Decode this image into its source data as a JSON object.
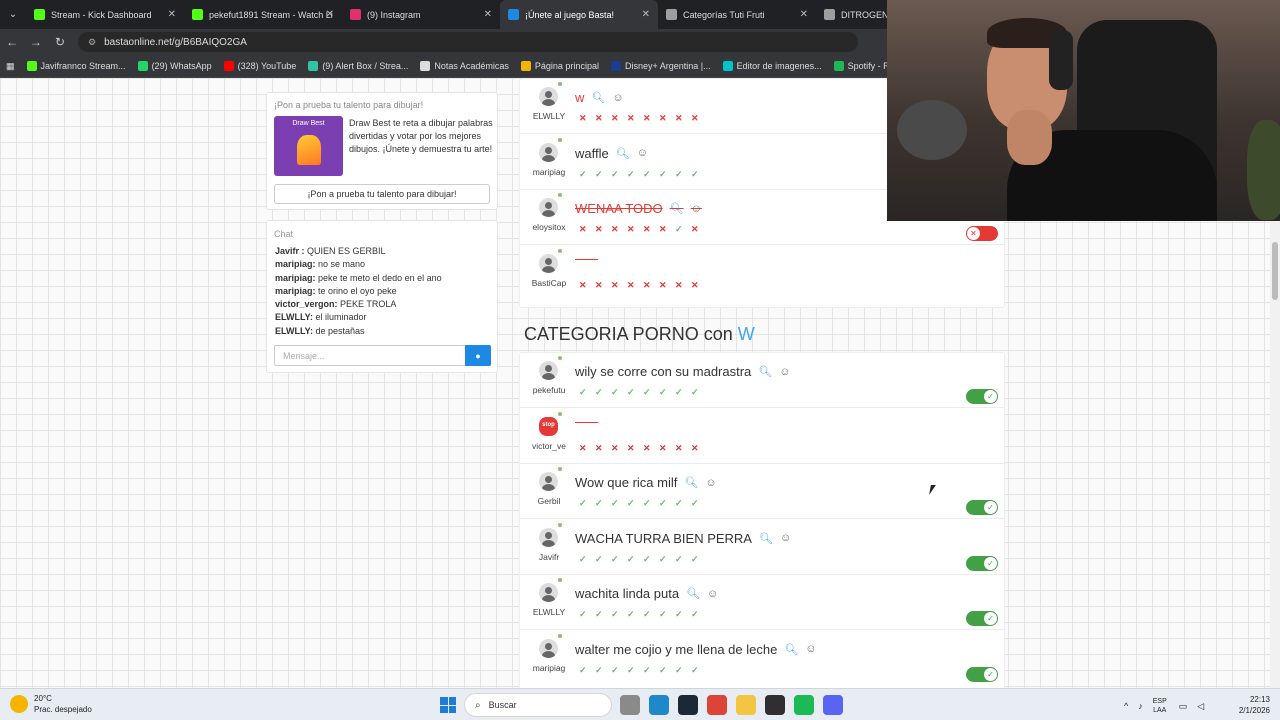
{
  "tabs": [
    {
      "label": "Stream - Kick Dashboard",
      "color": "#53fc18"
    },
    {
      "label": "pekefut1891 Stream - Watch Li",
      "color": "#53fc18"
    },
    {
      "label": "(9) Instagram",
      "color": "#e1306c"
    },
    {
      "label": "¡Únete al juego Basta!",
      "color": "#1e88e5",
      "active": true
    },
    {
      "label": "Categorías Tuti Fruti",
      "color": "#9e9e9e"
    },
    {
      "label": "DITROGENO",
      "color": "#9e9e9e"
    }
  ],
  "address": {
    "url": "bastaonline.net/g/B6BAIQO2GA"
  },
  "bookmarks": [
    {
      "label": "Javifrannco Stream...",
      "color": "#53fc18"
    },
    {
      "label": "(29) WhatsApp",
      "color": "#25d366"
    },
    {
      "label": "(328) YouTube",
      "color": "#ff0000"
    },
    {
      "label": "(9) Alert Box / Strea...",
      "color": "#31c3a2"
    },
    {
      "label": "Notas Académicas",
      "color": "#dddddd"
    },
    {
      "label": "Página principal",
      "color": "#f4b400"
    },
    {
      "label": "Disney+ Argentina |...",
      "color": "#1a3d8f"
    },
    {
      "label": "Editor de imagenes...",
      "color": "#00c4cc"
    },
    {
      "label": "Spotify - Reproduct...",
      "color": "#1db954"
    }
  ],
  "promo": {
    "title": "¡Pon a prueba tu talento para dibujar!",
    "image_label": "Draw Best",
    "text": "Draw Best te reta a dibujar palabras divertidas y votar por los mejores dibujos. ¡Únete y demuestra tu arte!",
    "button": "¡Pon a prueba tu talento para dibujar!"
  },
  "chat": {
    "title": "Chat",
    "messages": [
      {
        "user": "Javifr :",
        "text": "QUIEN ES GERBIL"
      },
      {
        "user": "maripiag:",
        "text": "no se mano"
      },
      {
        "user": "maripiag:",
        "text": "peke te meto el dedo en el ano"
      },
      {
        "user": "maripiag:",
        "text": "te orino el oyo peke"
      },
      {
        "user": "victor_vergon:",
        "text": "PEKE TROLA"
      },
      {
        "user": "ELWLLY:",
        "text": "el iluminador"
      },
      {
        "user": "ELWLLY:",
        "text": "de pestañas"
      }
    ],
    "placeholder": "Mensaje..."
  },
  "section1": {
    "rows": [
      {
        "user": "ELWLLY",
        "answer": "w",
        "style": "red",
        "votes": "xxxxxxxx"
      },
      {
        "user": "maripiag",
        "answer": "waffle",
        "style": "normal",
        "votes": "vvvvvvvv"
      },
      {
        "user": "eloysitox",
        "answer": "WENAA TODO",
        "style": "wrong",
        "votes": "xxxxxxvx",
        "toggle": "off"
      },
      {
        "user": "BastiCap",
        "answer": "",
        "style": "blank",
        "votes": "xxxxxxxx"
      }
    ]
  },
  "section2": {
    "title": "CATEGORIA PORNO con",
    "letter": "W",
    "rows": [
      {
        "user": "pekefutu",
        "answer": "wily se corre con su madrastra",
        "style": "normal",
        "votes": "vvvvvvvv",
        "toggle": "on"
      },
      {
        "user": "victor_ve",
        "answer": "",
        "style": "blank",
        "votes": "xxxxxxxx",
        "avatar": "stop"
      },
      {
        "user": "Gerbil",
        "answer": "Wow que rica milf",
        "style": "normal",
        "votes": "vvvvvvvv",
        "toggle": "on"
      },
      {
        "user": "Javifr",
        "answer": "WACHA TURRA BIEN PERRA",
        "style": "normal",
        "votes": "vvvvvvvv",
        "toggle": "on"
      },
      {
        "user": "ELWLLY",
        "answer": "wachita linda puta",
        "style": "normal",
        "votes": "vvvvvvvv",
        "toggle": "on"
      },
      {
        "user": "maripiag",
        "answer": "walter me cojio y me llena de leche",
        "style": "normal",
        "votes": "vvvvvvvv",
        "toggle": "on"
      }
    ]
  },
  "taskbar": {
    "temp": "20°C",
    "weather": "Prac. despejado",
    "search": "Buscar",
    "lang1": "ESP",
    "lang2": "LAA",
    "time": "22:13",
    "date": "2/1/2026",
    "icons": [
      {
        "name": "file-explorer-icon",
        "color": "#8a8a8a"
      },
      {
        "name": "edge-icon",
        "color": "#1e88c8"
      },
      {
        "name": "steam-icon",
        "color": "#1b2838"
      },
      {
        "name": "chrome-icon",
        "color": "#db4437"
      },
      {
        "name": "folder-icon",
        "color": "#f4c542"
      },
      {
        "name": "obs-icon",
        "color": "#302e31"
      },
      {
        "name": "spotify-icon",
        "color": "#1db954"
      },
      {
        "name": "discord-icon",
        "color": "#5865f2"
      }
    ]
  }
}
